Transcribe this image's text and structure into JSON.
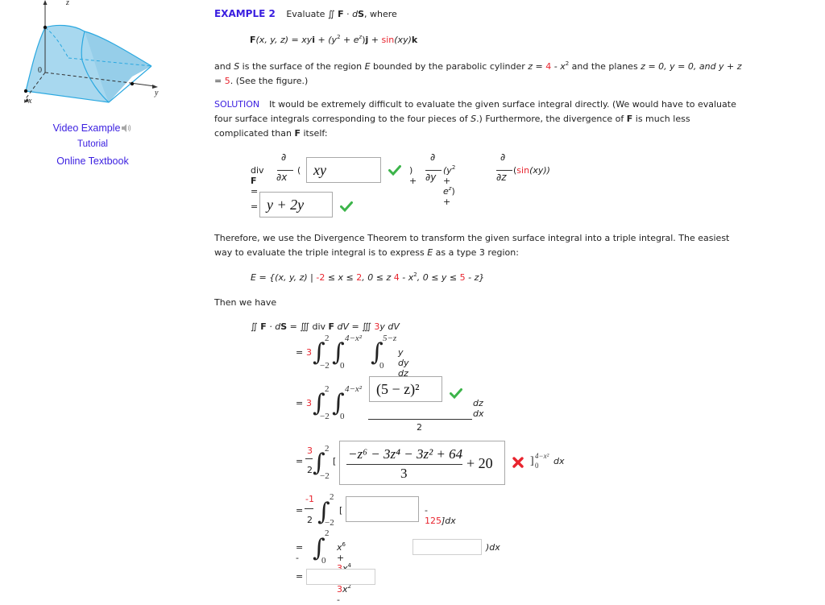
{
  "figure": {
    "alt": "3D region bounded by parabolic cylinder and planes",
    "axis_labels": {
      "x": "x",
      "y": "y",
      "z": "z",
      "origin": "0"
    },
    "fill_color": "#a8d8ef",
    "edge_color": "#2aa8e0"
  },
  "sidebar": {
    "links": [
      {
        "label": "Video Example",
        "icon": "speaker-icon"
      },
      {
        "label": "Tutorial"
      },
      {
        "label": "Online Textbook"
      }
    ]
  },
  "example": {
    "label": "EXAMPLE 2",
    "intro": "Evaluate ∬ ",
    "intro_F": "F",
    "intro_dot": " · ",
    "intro_d": "d",
    "intro_S": "S",
    "intro_where": ", where",
    "field": {
      "F": "F",
      "args": "(x, y, z) = xy",
      "i": "i",
      "plus1": " + (y",
      "sq": "2",
      "plus_e": " + e",
      "ez": "z",
      "close_j": ")",
      "j": "j",
      "plus2": " + ",
      "sin": "sin",
      "xy": "(xy)",
      "k": "k"
    },
    "surface_line1_a": "and ",
    "S": "S",
    "surface_line1_b": " is the surface of the region ",
    "E": "E",
    "surface_line1_c": " bounded by the parabolic cylinder ",
    "z_eq": "z = ",
    "four": "4",
    "minus_x": " - x",
    "x_sq": "2",
    "surface_line1_d": " and the planes ",
    "planes": "z = 0, y = 0, and y + z",
    "line2_eq": "= ",
    "five": "5",
    "line2_rest": ". (See the figure.)"
  },
  "solution": {
    "label": "SOLUTION",
    "text_a": "It would be extremely difficult to evaluate the given surface integral directly. (We would have to evaluate",
    "text_b1": "four surface integrals corresponding to the four pieces of ",
    "text_b_S": "S",
    "text_b2": ".) Furthermore, the divergence of ",
    "text_b_F": "F",
    "text_b3": " is much less",
    "text_c1": "complicated than ",
    "text_c_F": "F",
    "text_c2": " itself:"
  },
  "divergence": {
    "lhs": "div ",
    "lhs_F": "F",
    "eq": " =",
    "partial": "∂",
    "dx": "∂x",
    "dy": "∂y",
    "dz": "∂z",
    "open": "(",
    "answer1": "xy",
    "answer1_status": "correct",
    "close_plus": ") +",
    "term2": "(y",
    "term2_sq": "2",
    "term2_b": " + e",
    "term2_z": "z",
    "term2_c": ") +",
    "term3_open": "(",
    "term3_sin": "sin",
    "term3_rest": "(xy))",
    "result_eq": "=",
    "answer2": "y + 2y",
    "answer2_status": "correct"
  },
  "therefore": {
    "line1": "Therefore, we use the Divergence Theorem to transform the given surface integral into a triple integral. The easiest",
    "line2_a": "way to evaluate the triple integral is to express ",
    "line2_E": "E",
    "line2_b": " as a type 3 region:"
  },
  "region": {
    "a": "E = {(x, y, z) | ",
    "neg2": "-2",
    "b": " ≤ x ≤ ",
    "two": "2",
    "c": ", 0 ≤ z ",
    "four": "4",
    "d": " - x",
    "sq": "2",
    "e": ", 0 ≤ y ≤ ",
    "five": "5",
    "f": " - z}"
  },
  "then": "Then we have",
  "steps": {
    "s0_a": "∬ ",
    "s0_F": "F",
    "s0_b": " · d",
    "s0_S": "S",
    "s0_c": " = ∭ div ",
    "s0_F2": "F",
    "s0_d": " dV = ∭ ",
    "s0_3": "3",
    "s0_e": "y dV",
    "eq": "=",
    "coef3": "3",
    "lim_x_upper": "2",
    "lim_x_lower": "−2",
    "lim_z_upper": "4−x²",
    "lim_z_lower": "0",
    "lim_y_upper": "5−z",
    "lim_y_lower": "0",
    "s1_integrand": "y dy dz dx",
    "s2_answer": "(5 − z)²",
    "s2_answer_status": "correct",
    "s2_denom": "2",
    "s2_tail": "dz dx",
    "s3_num": "3",
    "s3_den": "2",
    "s3_bracket": "[",
    "s3_answer_num": "−z⁶ − 3z⁴ − 3z² + 64",
    "s3_answer_den": "3",
    "s3_answer_tail": "+ 20",
    "s3_answer_status": "incorrect",
    "s3_eval_upper": "4−x²",
    "s3_eval_lower": "0",
    "s3_tail": "dx",
    "s4_num": "-1",
    "s4_den": "2",
    "s4_bracket": "[",
    "s4_answer": "",
    "s4_tail_a": " - ",
    "s4_125": "125",
    "s4_tail_b": "]dx",
    "s5_eq": "= -",
    "s5_a": "x",
    "s5_6": "6",
    "s5_b": " + ",
    "s5_3a": "3",
    "s5_c": "x",
    "s5_4": "4",
    "s5_d": " + ",
    "s5_3b": "3",
    "s5_e": "x",
    "s5_2": "2",
    "s5_f": " - ",
    "s5_answer": "",
    "s5_tail": ")dx",
    "s5_upper": "2",
    "s5_lower": "0",
    "s6_answer": ""
  },
  "colors": {
    "accent_blue": "#3a1ee0",
    "highlight_red": "#e8242e",
    "check_green": "#3cb44a",
    "cross_red": "#e8242e"
  }
}
